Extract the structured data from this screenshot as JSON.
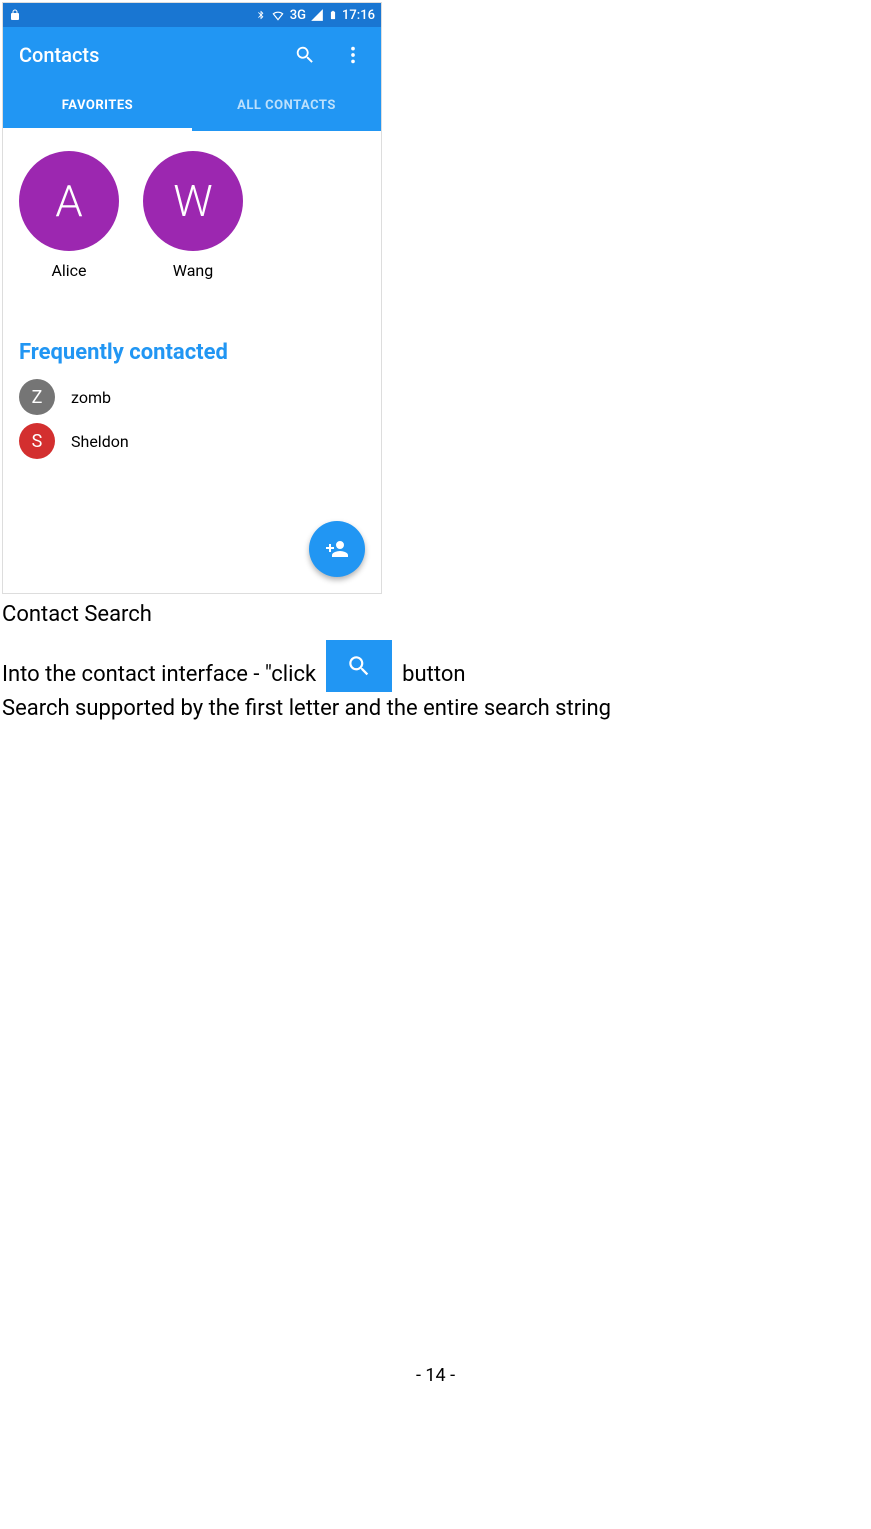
{
  "status_bar": {
    "lock_icon": "lock-icon",
    "bluetooth_icon": "bluetooth-icon",
    "wifi_icon": "wifi-icon",
    "network_label": "3G",
    "signal_icon": "signal-icon",
    "battery_icon": "battery-icon",
    "time": "17:16"
  },
  "app_bar": {
    "title": "Contacts",
    "search_icon": "search-icon",
    "overflow_icon": "more-vert-icon"
  },
  "tabs": [
    {
      "label": "FAVORITES",
      "active": true
    },
    {
      "label": "ALL CONTACTS",
      "active": false
    }
  ],
  "favorites": [
    {
      "initial": "A",
      "name": "Alice",
      "color": "#9c27b0"
    },
    {
      "initial": "W",
      "name": "Wang",
      "color": "#9c27b0"
    }
  ],
  "section_header": "Frequently contacted",
  "frequent": [
    {
      "initial": "Z",
      "name": "zomb",
      "color": "#757575"
    },
    {
      "initial": "S",
      "name": "Sheldon",
      "color": "#d32f2f"
    }
  ],
  "fab_icon": "add-person-icon",
  "doc": {
    "heading": "Contact Search",
    "line1_pre": "Into the contact interface - \"click",
    "line1_post": "button",
    "line2": "Search supported by the first letter and the entire search string",
    "page_number": "- 14 -"
  }
}
